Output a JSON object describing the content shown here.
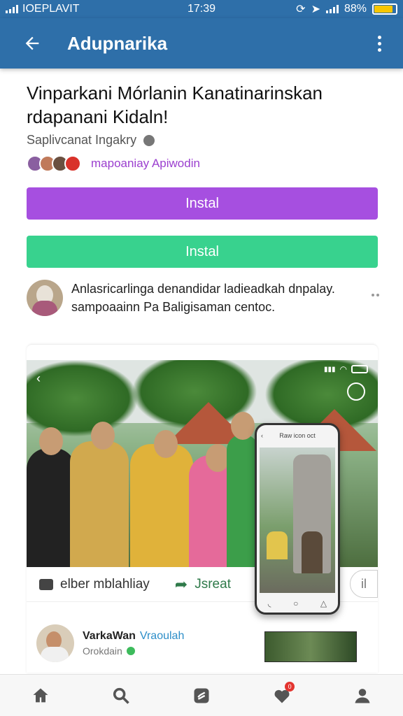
{
  "status_bar": {
    "carrier": "IOEPLAVIT",
    "time": "17:39",
    "battery": "88%",
    "battery_level": 0.88
  },
  "app_bar": {
    "title": "Adupnarika"
  },
  "post": {
    "headline": "Vinparkani Mórlanin Kanatinarinskan rdapanani Kidaln!",
    "subline": "Saplivcanat Ingakry",
    "friends_text": "mapoaniay Apiwodin"
  },
  "buttons": {
    "primary_label": "Instal",
    "secondary_label": "Instal"
  },
  "comment": {
    "text": "Anlasricarlinga denandidar ladieadkah dnpalay. sampoaainn Pa Baligisaman centoc."
  },
  "card": {
    "phone_header": "Raw icon oct",
    "action_like": "elber mblahliay",
    "action_share": "Jsreat",
    "action_extra": "il"
  },
  "post_row": {
    "name": "VarkaWan",
    "name_link": "Vraoulah",
    "sub": "Orokdain"
  },
  "bottom_nav": {
    "badge": "0"
  },
  "colors": {
    "app_bar": "#2e6fa9",
    "primary_button": "#a64fe0",
    "secondary_button": "#38d28e",
    "friends_text": "#9b3fcf",
    "link": "#2d8ec8"
  },
  "icons": [
    "back-arrow-icon",
    "more-vert-icon",
    "globe-icon",
    "home-icon",
    "search-icon",
    "app-icon",
    "heart-icon",
    "profile-icon"
  ]
}
